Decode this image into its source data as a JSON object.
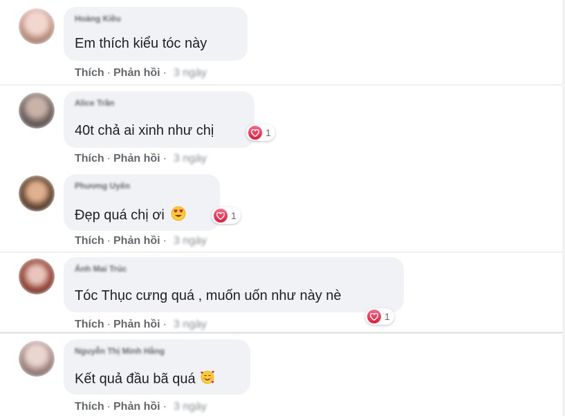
{
  "comments": [
    {
      "name": "Hoàng Kiều",
      "text": "Em thích kiểu tóc này",
      "like": "Thích",
      "reply": "Phản hồi",
      "dot": "·",
      "time": "3 ngày",
      "reactions": null
    },
    {
      "name": "Alice Trần",
      "text": "40t chả ai xinh như chị",
      "like": "Thích",
      "reply": "Phản hồi",
      "dot": "·",
      "time": "3 ngày",
      "reactions": "1"
    },
    {
      "name": "Phương Uyên",
      "text": "Đẹp quá chị ơi",
      "like": "Thích",
      "reply": "Phản hồi",
      "dot": "·",
      "time": "3 ngày",
      "reactions": "1",
      "emoji": "heart-eyes"
    },
    {
      "name": "Ánh Mai Trúc",
      "text": "Tóc Thục cưng quá , muốn uốn như này nè",
      "like": "Thích",
      "reply": "Phản hồi",
      "dot": "·",
      "time": "3 ngày",
      "reactions": "1"
    },
    {
      "name": "Nguyễn Thị Minh Hằng",
      "text": "Kết quả đầu bã quá",
      "like": "Thích",
      "reply": "Phản hồi",
      "dot": "·",
      "time": "3 ngày",
      "reactions": null,
      "emoji": "smiling-hearts"
    }
  ],
  "colors": {
    "bubble": "#f0f2f5",
    "action": "#65676b",
    "heart": "#e61739"
  }
}
